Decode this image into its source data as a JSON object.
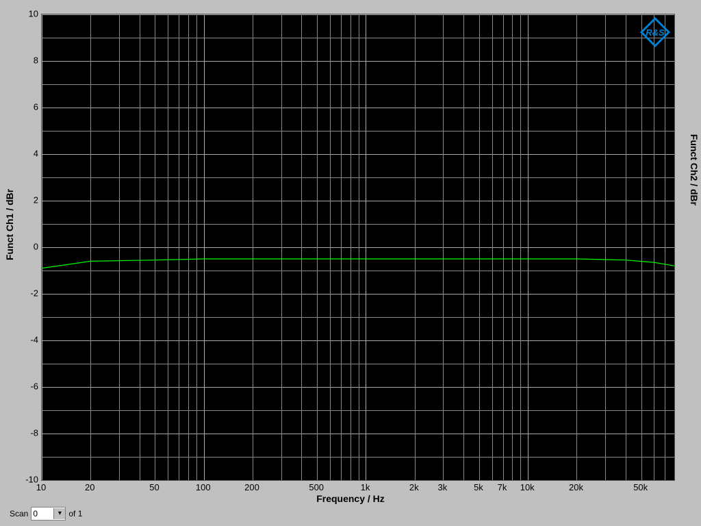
{
  "chart_data": {
    "type": "line",
    "title": "",
    "xlabel": "Frequency / Hz",
    "ylabel_left": "Funct Ch1 / dBr",
    "ylabel_right": "Funct Ch2 / dBr",
    "xscale": "log",
    "xlim": [
      10,
      80000
    ],
    "ylim": [
      -10,
      10
    ],
    "xticks": [
      10,
      20,
      50,
      100,
      200,
      500,
      1000,
      2000,
      3000,
      5000,
      7000,
      10000,
      20000,
      50000
    ],
    "xtick_labels": [
      "10",
      "20",
      "50",
      "100",
      "200",
      "500",
      "1k",
      "2k",
      "3k",
      "5k",
      "7k",
      "10k",
      "20k",
      "50k"
    ],
    "yticks": [
      -10,
      -8,
      -6,
      -4,
      -2,
      0,
      2,
      4,
      6,
      8,
      10
    ],
    "series": [
      {
        "name": "Funct Ch1",
        "color": "#00ff00",
        "x": [
          10,
          20,
          50,
          100,
          200,
          500,
          1000,
          2000,
          5000,
          10000,
          20000,
          40000,
          60000,
          80000
        ],
        "y": [
          -0.9,
          -0.6,
          -0.55,
          -0.5,
          -0.5,
          -0.5,
          -0.5,
          -0.5,
          -0.5,
          -0.5,
          -0.5,
          -0.55,
          -0.65,
          -0.8
        ]
      }
    ]
  },
  "scan": {
    "label": "Scan",
    "value": "0",
    "of_label": "of 1"
  },
  "logo_alt": "rohde-schwarz-logo"
}
